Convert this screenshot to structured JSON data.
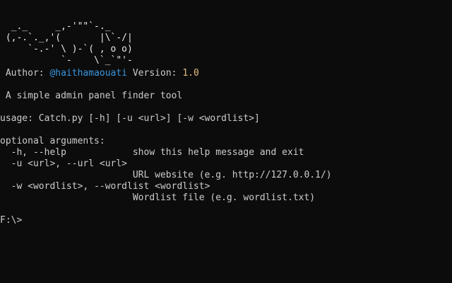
{
  "banner": {
    "ascii_lines": [
      "  _._     _,-'\"\"`-._",
      " (,-.`._,'(       |\\`-/|",
      "     `-.-' \\ )-`( , o o)",
      "           `-    \\`_`\"'-"
    ]
  },
  "info": {
    "author_label": " Author: ",
    "author_handle": "@haithamaouati",
    "version_label": " Version: ",
    "version_value": "1.0",
    "description": " A simple admin panel finder tool"
  },
  "usage": {
    "line": "usage: Catch.py [-h] [-u <url>] [-w <wordlist>]"
  },
  "help": {
    "header": "optional arguments:",
    "args": [
      {
        "flag": "  -h, --help            ",
        "desc": "show this help message and exit"
      },
      {
        "flag": "  -u <url>, --url <url>",
        "desc": ""
      },
      {
        "flag": "                        ",
        "desc": "URL website (e.g. http://127.0.0.1/)"
      },
      {
        "flag": "  -w <wordlist>, --wordlist <wordlist>",
        "desc": ""
      },
      {
        "flag": "                        ",
        "desc": "Wordlist file (e.g. wordlist.txt)"
      }
    ]
  },
  "prompt": {
    "text": "F:\\>"
  },
  "colors": {
    "background": "#0c0c0c",
    "foreground": "#cccccc",
    "handle": "#3a96dd",
    "version": "#e5c07b"
  }
}
